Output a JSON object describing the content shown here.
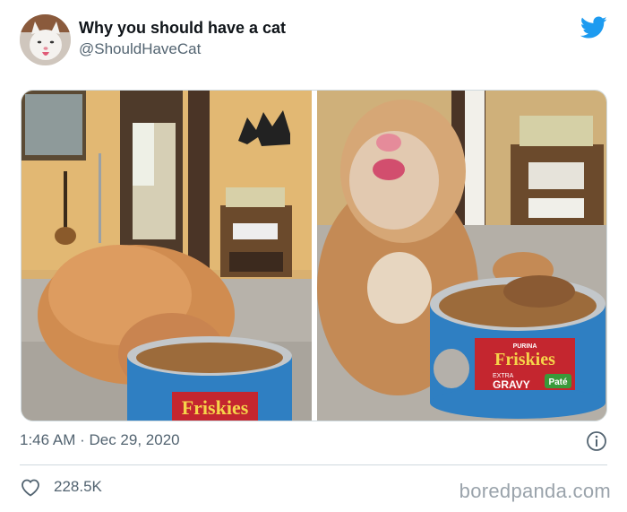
{
  "tweet": {
    "author_name": "Why you should have a cat",
    "author_handle": "@ShouldHaveCat",
    "timestamp": "1:46 AM · Dec 29, 2020",
    "likes": "228.5K"
  },
  "photos": {
    "left_can_label": "Friskies",
    "right_can_brand": "PURINA",
    "right_can_label": "Friskies",
    "right_can_sub1": "EXTRA",
    "right_can_sub2": "GRAVY",
    "right_can_sub3": "Paté"
  },
  "watermark": "boredpanda.com",
  "colors": {
    "twitter_blue": "#1d9bf0",
    "text_secondary": "#536471",
    "divider": "#cfd9de"
  },
  "icons": [
    "twitter-bird-icon",
    "info-icon",
    "heart-icon"
  ]
}
